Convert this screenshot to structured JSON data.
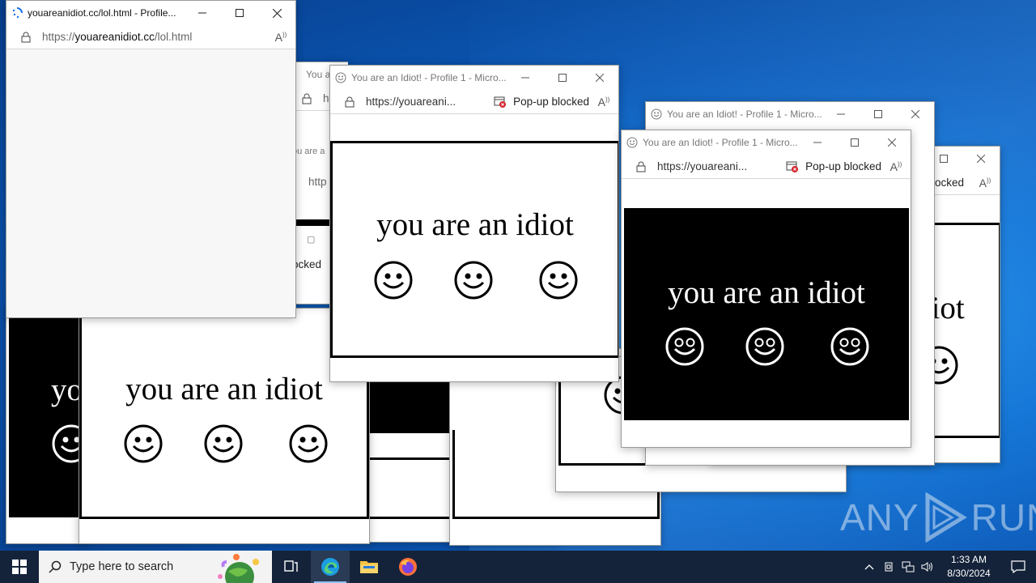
{
  "browser": {
    "main_title": "youareanidiot.cc/lol.html - Profile...",
    "main_url_scheme": "https://",
    "main_url_host": "youareanidiot.cc",
    "main_url_path": "/lol.html",
    "popup_title": "You are an Idiot! - Profile 1 - Micro...",
    "popup_title_short": "You a",
    "popup_url": "https://youareani...",
    "popup_url_fragment": "http",
    "popup_url_partial": "ou are a",
    "blocked_label": "Pop-up blocked",
    "blocked_partial": "blocked",
    "blocked_partial2": "ocked"
  },
  "content": {
    "message": "you are an idiot",
    "message_partial_left": "yo",
    "message_partial_right": "diot"
  },
  "taskbar": {
    "search_placeholder": "Type here to search",
    "time": "1:33 AM",
    "date": "8/30/2024"
  },
  "watermark": {
    "left": "ANY",
    "right": "RUN"
  },
  "colors": {
    "taskbar": "#14233a",
    "desktop": "#0c6fd1",
    "edge_accent": "#8fc1f5"
  }
}
